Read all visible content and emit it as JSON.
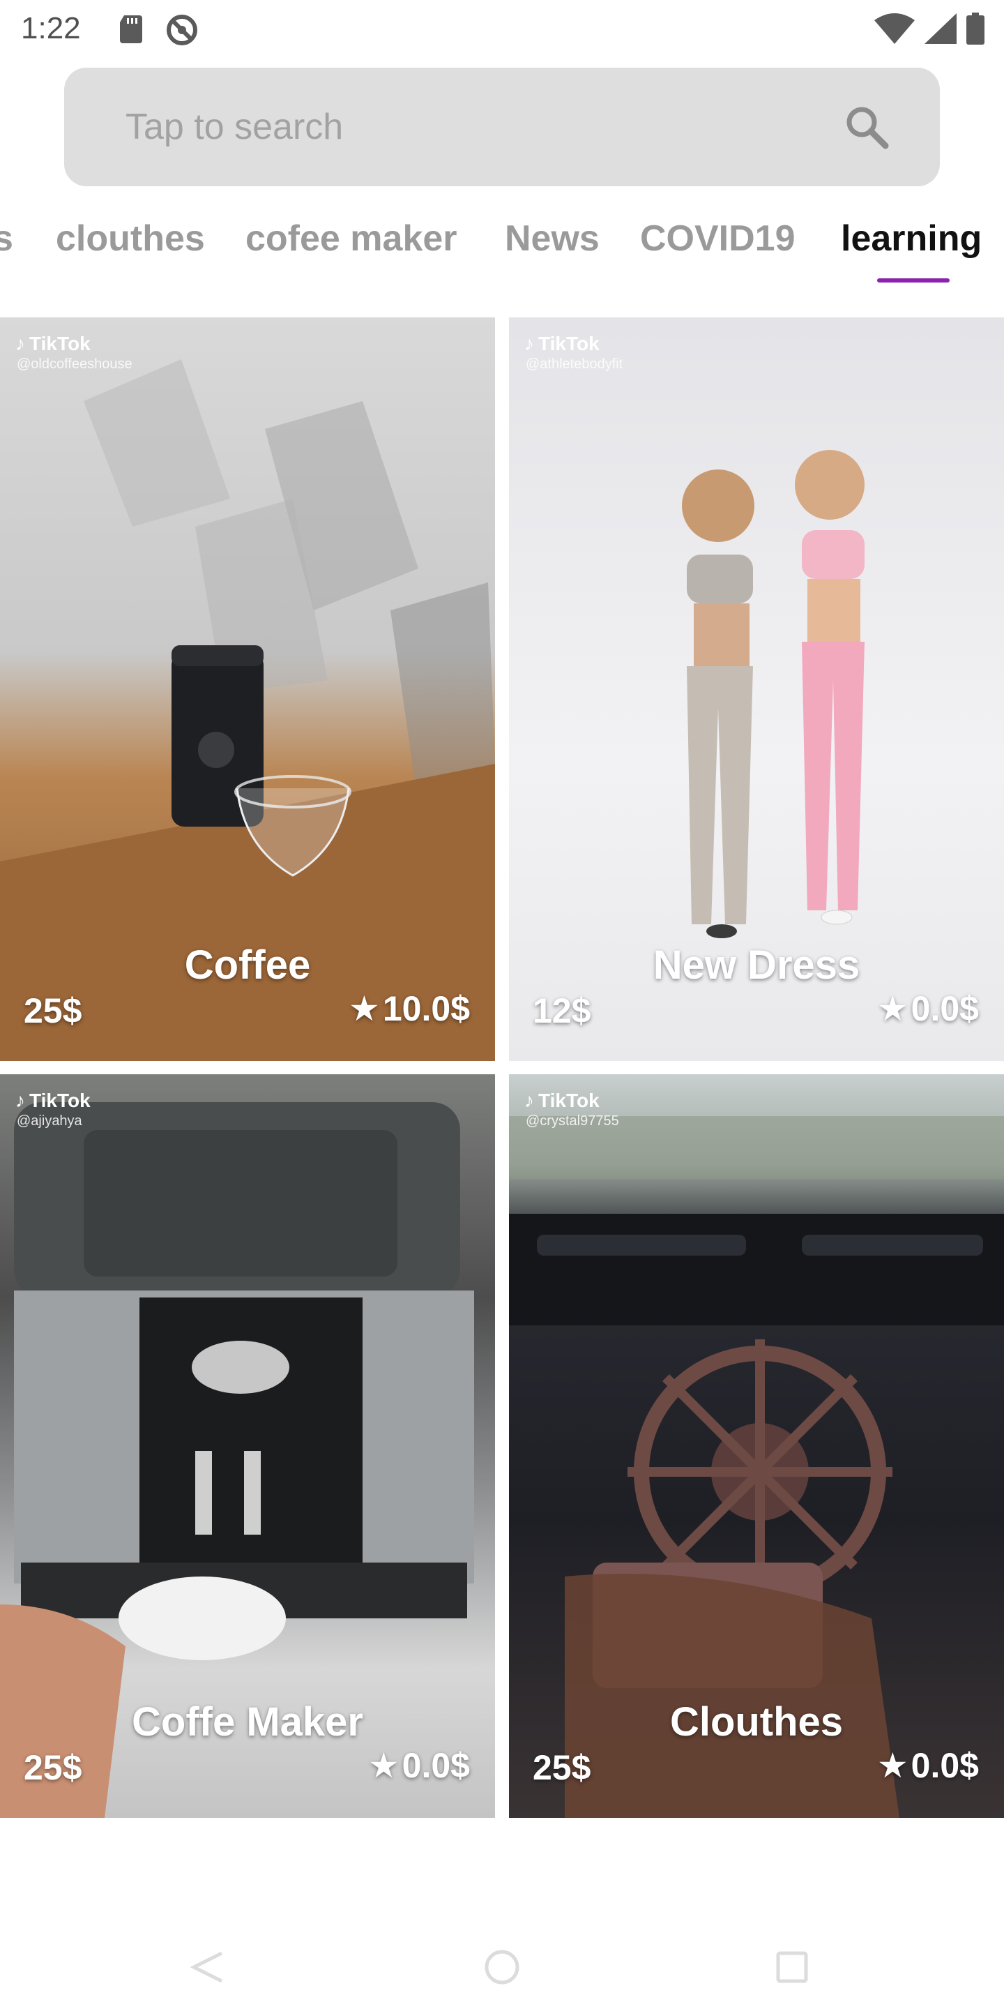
{
  "status_bar": {
    "time": "1:22",
    "icons": [
      "sd-card-icon",
      "do-not-disturb-icon",
      "wifi-icon",
      "signal-icon",
      "battery-icon"
    ]
  },
  "search": {
    "placeholder": "Tap to search",
    "icon": "search-icon"
  },
  "tabs": [
    {
      "label": "s",
      "active": false
    },
    {
      "label": "clouthes",
      "active": false
    },
    {
      "label": "cofee maker",
      "active": false
    },
    {
      "label": "News",
      "active": false
    },
    {
      "label": "COVID19",
      "active": false
    },
    {
      "label": "learning",
      "active": true
    }
  ],
  "accent_color": "#8a24b0",
  "products": [
    {
      "title": "Coffee",
      "price": "25$",
      "rating": "10.0$",
      "watermark": "TikTok",
      "user": "@oldcoffeeshouse"
    },
    {
      "title": "New Dress",
      "price": "12$",
      "rating": "0.0$",
      "watermark": "TikTok",
      "user": "@athletebodyfit"
    },
    {
      "title": "Coffe Maker",
      "price": "25$",
      "rating": "0.0$",
      "watermark": "TikTok",
      "user": "@ajiyahya"
    },
    {
      "title": "Clouthes",
      "price": "25$",
      "rating": "0.0$",
      "watermark": "TikTok",
      "user": "@crystal97755"
    }
  ],
  "nav_bar": {
    "icons": [
      "back-icon",
      "home-icon",
      "recent-apps-icon"
    ]
  }
}
